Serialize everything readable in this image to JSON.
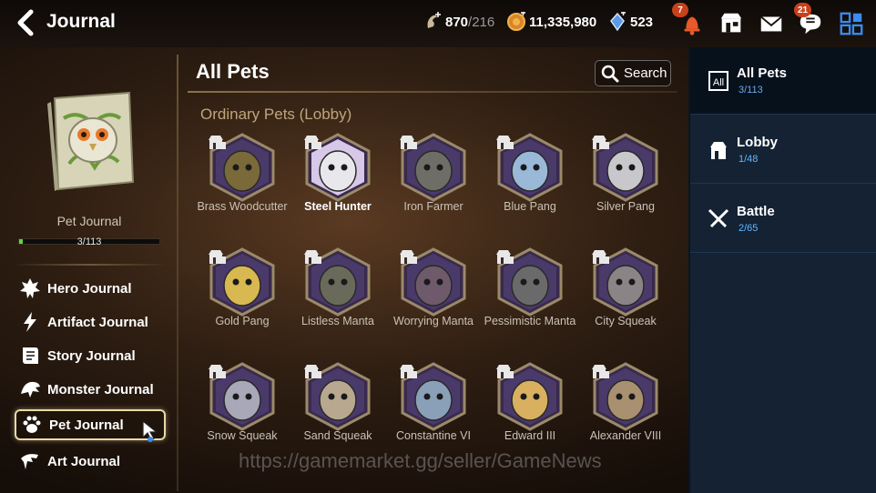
{
  "header": {
    "title": "Journal",
    "stamina": "870",
    "stamina_max": "/216",
    "gold": "11,335,980",
    "crystals": "523",
    "notif_badge": "7",
    "chat_badge": "21"
  },
  "left": {
    "book_label": "Pet Journal",
    "progress_text": "3/113",
    "progress_fraction": 0.027,
    "menu": [
      {
        "label": "Hero Journal",
        "icon": "hero-icon"
      },
      {
        "label": "Artifact Journal",
        "icon": "artifact-icon"
      },
      {
        "label": "Story Journal",
        "icon": "story-icon"
      },
      {
        "label": "Monster Journal",
        "icon": "monster-icon"
      },
      {
        "label": "Pet Journal",
        "icon": "paw-icon",
        "active": true
      },
      {
        "label": "Art Journal",
        "icon": "art-icon"
      }
    ]
  },
  "main": {
    "title": "All Pets",
    "search_label": "Search",
    "section_title": "Ordinary Pets (Lobby)",
    "pets": [
      {
        "name": "Brass Woodcutter",
        "color": "#7a6a3a"
      },
      {
        "name": "Steel Hunter",
        "color": "#e8e8ec",
        "unlocked": true
      },
      {
        "name": "Iron Farmer",
        "color": "#6e6e66"
      },
      {
        "name": "Blue Pang",
        "color": "#9ab8d8"
      },
      {
        "name": "Silver Pang",
        "color": "#c8c8cc"
      },
      {
        "name": "Gold Pang",
        "color": "#d8b850"
      },
      {
        "name": "Listless Manta",
        "color": "#6a6a5a"
      },
      {
        "name": "Worrying Manta",
        "color": "#6e5a6a"
      },
      {
        "name": "Pessimistic Manta",
        "color": "#6a6a6a"
      },
      {
        "name": "City Squeak",
        "color": "#8a8486"
      },
      {
        "name": "Snow Squeak",
        "color": "#a8a8b8"
      },
      {
        "name": "Sand Squeak",
        "color": "#b8a890"
      },
      {
        "name": "Constantine VI",
        "color": "#8aa0b8"
      },
      {
        "name": "Edward III",
        "color": "#d8b060"
      },
      {
        "name": "Alexander VIII",
        "color": "#a89070"
      }
    ],
    "watermark": "https://gamemarket.gg/seller/GameNews"
  },
  "tabs": [
    {
      "label": "All Pets",
      "count": "3/113",
      "icon": "all-icon",
      "active": true
    },
    {
      "label": "Lobby",
      "count": "1/48",
      "icon": "lobby-icon"
    },
    {
      "label": "Battle",
      "count": "2/65",
      "icon": "battle-icon"
    }
  ]
}
